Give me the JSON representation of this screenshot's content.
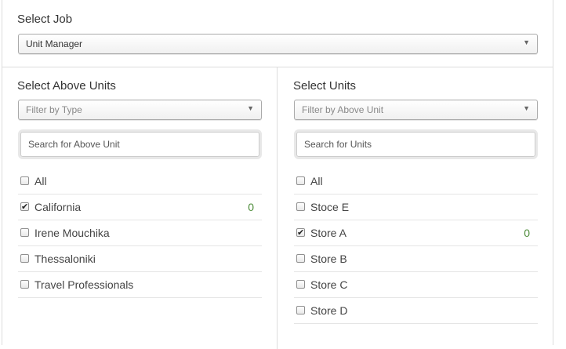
{
  "job": {
    "title": "Select Job",
    "selected": "Unit Manager"
  },
  "above_units": {
    "title": "Select Above Units",
    "filter_placeholder": "Filter by Type",
    "search_placeholder": "Search for Above Unit",
    "items": [
      {
        "label": "All",
        "checked": false,
        "count": ""
      },
      {
        "label": "California",
        "checked": true,
        "count": "0"
      },
      {
        "label": "Irene Mouchika",
        "checked": false,
        "count": ""
      },
      {
        "label": "Thessaloniki",
        "checked": false,
        "count": ""
      },
      {
        "label": "Travel Professionals",
        "checked": false,
        "count": ""
      }
    ]
  },
  "units": {
    "title": "Select Units",
    "filter_placeholder": "Filter by Above Unit",
    "search_placeholder": "Search for Units",
    "items": [
      {
        "label": "All",
        "checked": false,
        "count": ""
      },
      {
        "label": "Stoce E",
        "checked": false,
        "count": ""
      },
      {
        "label": "Store A",
        "checked": true,
        "count": "0"
      },
      {
        "label": "Store B",
        "checked": false,
        "count": ""
      },
      {
        "label": "Store C",
        "checked": false,
        "count": ""
      },
      {
        "label": "Store D",
        "checked": false,
        "count": ""
      }
    ]
  },
  "icons": {
    "dropdown": "chevron-down-icon",
    "check": "checkmark-icon"
  },
  "colors": {
    "count": "#4d8c3a",
    "border": "#dcdcdc"
  }
}
